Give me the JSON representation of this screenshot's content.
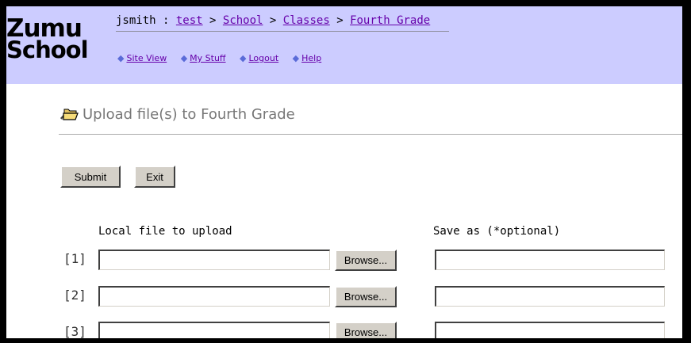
{
  "logo": {
    "line1": "Zumu",
    "line2": "School"
  },
  "breadcrumb": {
    "user": "jsmith",
    "separator": " : ",
    "arrow": " > ",
    "items": [
      "test",
      "School",
      "Classes",
      "Fourth Grade"
    ]
  },
  "toplinks": {
    "bullet": "◆",
    "items": [
      "Site View",
      "My Stuff",
      "Logout",
      "Help"
    ]
  },
  "page": {
    "title": "Upload file(s) to Fourth Grade",
    "title_icon": "open-folder-icon"
  },
  "buttons": {
    "submit": "Submit",
    "exit": "Exit"
  },
  "table": {
    "local_header": "Local file to upload",
    "save_header": "Save as (*optional)",
    "browse_label": "Browse...",
    "rows": [
      {
        "index": "[1]",
        "file": "",
        "save_as": ""
      },
      {
        "index": "[2]",
        "file": "",
        "save_as": ""
      },
      {
        "index": "[3]",
        "file": "",
        "save_as": ""
      }
    ]
  },
  "colors": {
    "header_bg": "#ccccff",
    "link": "#6600aa",
    "bullet": "#5a6bd8",
    "button_face": "#d4d0c8"
  }
}
